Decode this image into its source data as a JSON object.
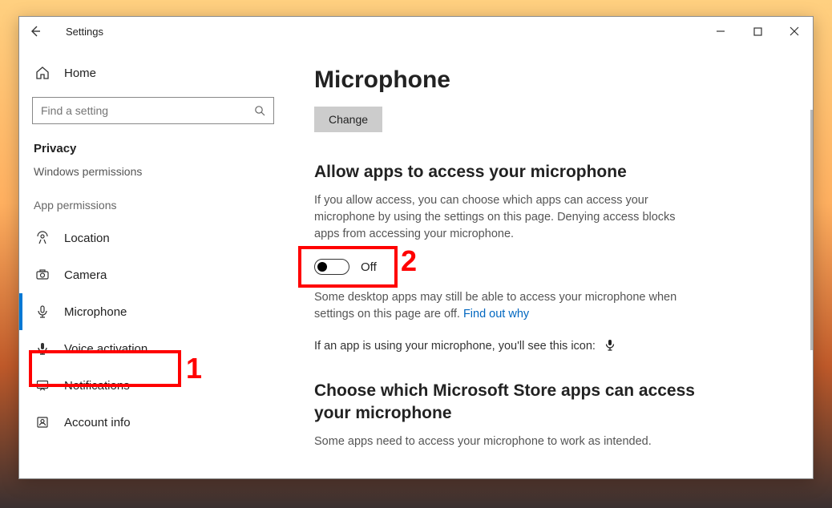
{
  "window": {
    "app_title": "Settings"
  },
  "sidebar": {
    "home": "Home",
    "search_placeholder": "Find a setting",
    "group_privacy": "Privacy",
    "windows_permissions": "Windows permissions",
    "group_app_permissions": "App permissions",
    "items": {
      "location": "Location",
      "camera": "Camera",
      "microphone": "Microphone",
      "voice_activation": "Voice activation",
      "notifications": "Notifications",
      "account_info": "Account info"
    }
  },
  "content": {
    "page_title": "Microphone",
    "change_btn": "Change",
    "allow_heading": "Allow apps to access your microphone",
    "allow_para": "If you allow access, you can choose which apps can access your microphone by using the settings on this page. Denying access blocks apps from accessing your microphone.",
    "toggle_state": "Off",
    "desktop_para_a": "Some desktop apps may still be able to access your microphone when settings on this page are off. ",
    "find_out_why": "Find out why",
    "icon_line": "If an app is using your microphone, you'll see this icon:",
    "store_heading": "Choose which Microsoft Store apps can access your microphone",
    "store_para": "Some apps need to access your microphone to work as intended."
  },
  "annotations": {
    "label1": "1",
    "label2": "2"
  }
}
